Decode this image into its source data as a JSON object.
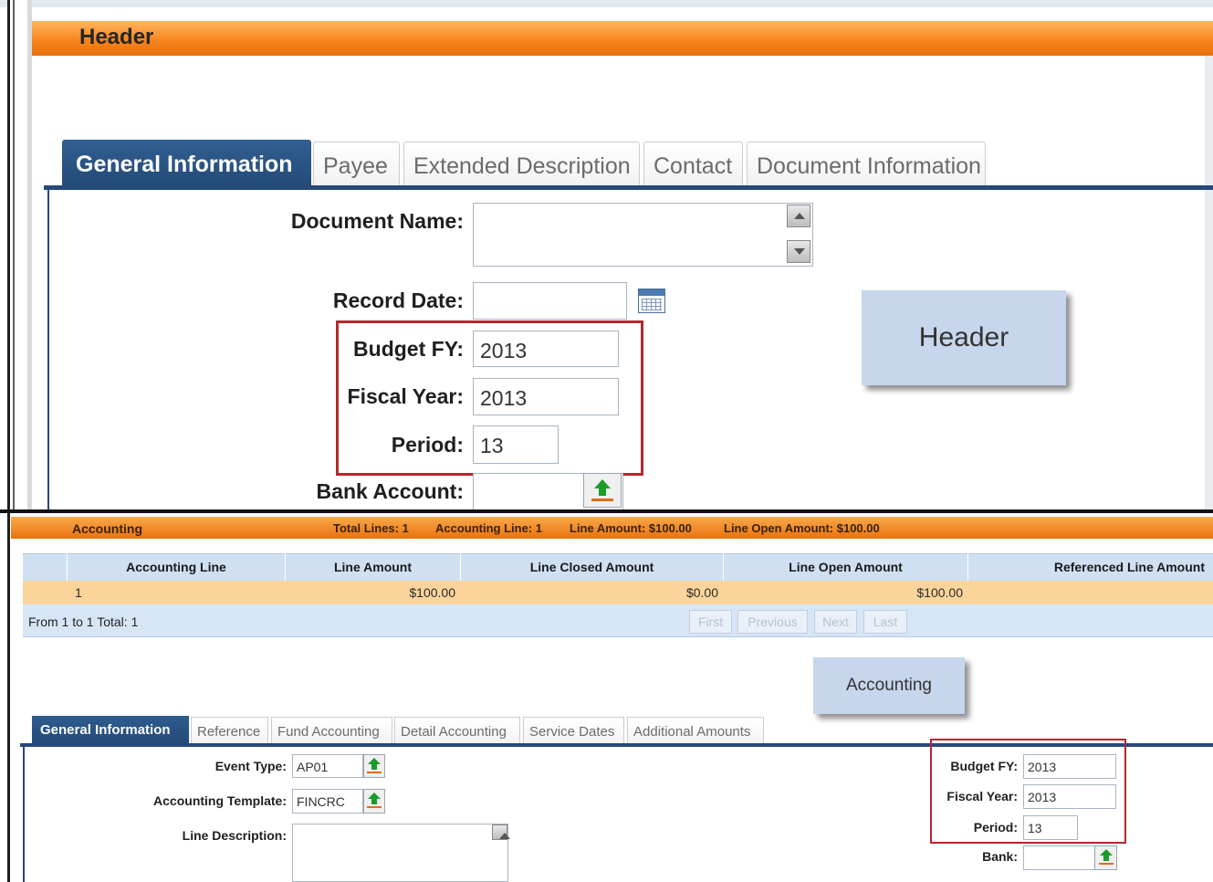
{
  "top": {
    "section_title": "Header",
    "tabs": [
      {
        "label": "General Information"
      },
      {
        "label": "Payee"
      },
      {
        "label": "Extended Description"
      },
      {
        "label": "Contact"
      },
      {
        "label": "Document Information"
      }
    ],
    "fields": {
      "document_name": {
        "label": "Document Name:",
        "value": ""
      },
      "record_date": {
        "label": "Record Date:",
        "value": ""
      },
      "budget_fy": {
        "label": "Budget FY:",
        "value": "2013"
      },
      "fiscal_year": {
        "label": "Fiscal Year:",
        "value": "2013"
      },
      "period": {
        "label": "Period:",
        "value": "13"
      },
      "bank_account": {
        "label": "Bank Account:",
        "value": ""
      }
    },
    "callout": "Header"
  },
  "accounting_bar": {
    "title": "Accounting",
    "total_lines": "Total Lines: 1",
    "accounting_line": "Accounting Line: 1",
    "line_amount": "Line Amount: $100.00",
    "line_open_amount": "Line Open Amount: $100.00"
  },
  "grid": {
    "columns": [
      "Accounting Line",
      "Line Amount",
      "Line Closed Amount",
      "Line Open Amount",
      "Referenced Line Amount"
    ],
    "rows": [
      {
        "accounting_line": "1",
        "line_amount": "$100.00",
        "line_closed_amount": "$0.00",
        "line_open_amount": "$100.00",
        "referenced_line_amount": ""
      }
    ],
    "footer": "From 1 to 1 Total: 1",
    "pager": {
      "first": "First",
      "previous": "Previous",
      "next": "Next",
      "last": "Last"
    }
  },
  "bottom": {
    "callout": "Accounting",
    "tabs": [
      {
        "label": "General Information"
      },
      {
        "label": "Reference"
      },
      {
        "label": "Fund Accounting"
      },
      {
        "label": "Detail Accounting"
      },
      {
        "label": "Service Dates"
      },
      {
        "label": "Additional Amounts"
      }
    ],
    "fields": {
      "event_type": {
        "label": "Event Type:",
        "value": "AP01"
      },
      "accounting_template": {
        "label": "Accounting Template:",
        "value": "FINCRC"
      },
      "line_description": {
        "label": "Line Description:",
        "value": ""
      },
      "budget_fy": {
        "label": "Budget FY:",
        "value": "2013"
      },
      "fiscal_year": {
        "label": "Fiscal Year:",
        "value": "2013"
      },
      "period": {
        "label": "Period:",
        "value": "13"
      },
      "bank": {
        "label": "Bank:",
        "value": ""
      }
    }
  },
  "colors": {
    "header_orange": "#f7861e",
    "tab_active": "#234a77",
    "highlight_box": "#b3282d",
    "callout_bg": "#c6d6ec",
    "grid_selected_row": "#fbd49b"
  },
  "icons": {
    "calendar": "calendar-icon",
    "lookup": "lookup-arrow-icon",
    "scroll_up": "scroll-up-icon",
    "scroll_down": "scroll-down-icon"
  }
}
